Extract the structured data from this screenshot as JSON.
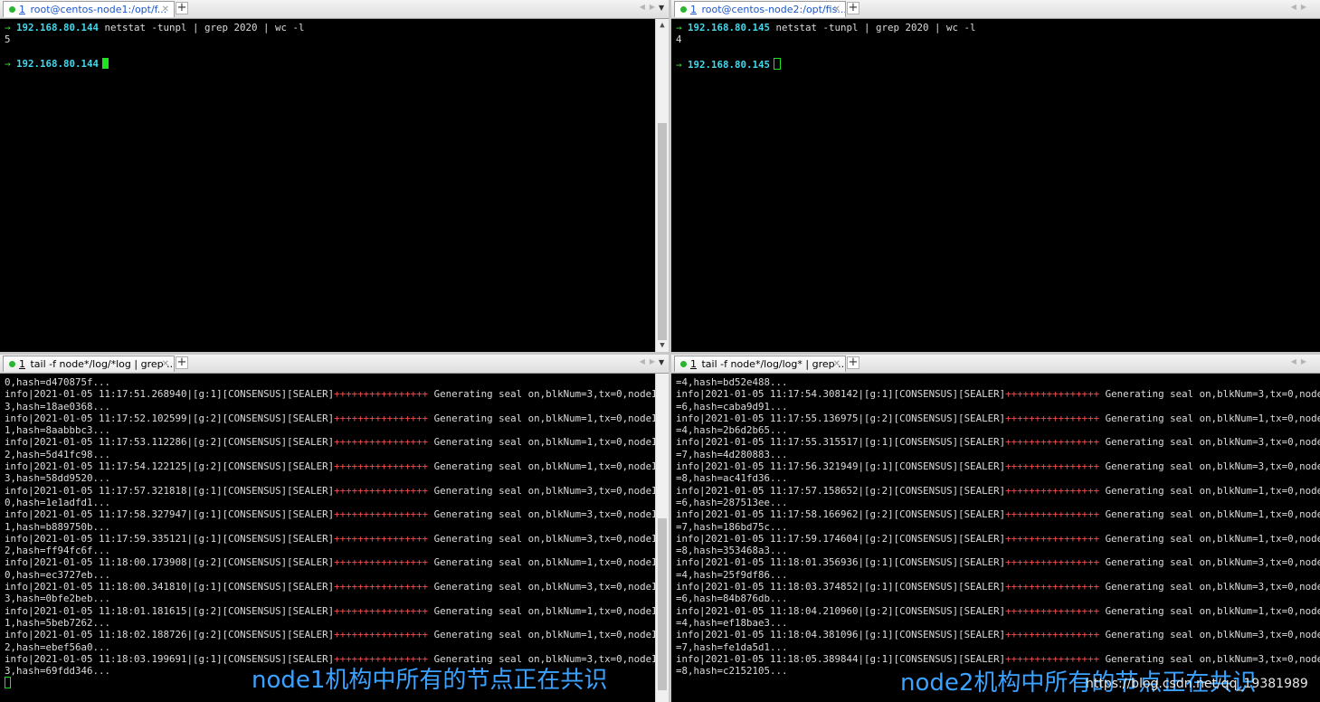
{
  "panes": {
    "top_left": {
      "tab": {
        "num": "1",
        "title": " root@centos-node1:/opt/f..."
      },
      "commands": [
        {
          "host": "192.168.80.144",
          "cmd": " netstat -tunpl | grep 2020 | wc -l"
        },
        {
          "output": "5"
        },
        {
          "output": ""
        },
        {
          "host": "192.168.80.144",
          "cmd": ""
        }
      ]
    },
    "top_right": {
      "tab": {
        "num": "1",
        "title": " root@centos-node2:/opt/fis..."
      },
      "commands": [
        {
          "host": "192.168.80.145",
          "cmd": " netstat -tunpl | grep 2020 | wc -l"
        },
        {
          "output": "4"
        },
        {
          "output": ""
        },
        {
          "host": "192.168.80.145",
          "cmd": ""
        }
      ]
    },
    "bottom_left": {
      "tab": {
        "num": "1",
        "title": " tail -f node*/log/*log | grep ..."
      },
      "first_line": "0,hash=d470875f...",
      "logs": [
        {
          "time": "2021-01-05 11:17:51.268940",
          "group": "1",
          "blk": "3",
          "idx": "3",
          "hash": "18ae0368..."
        },
        {
          "time": "2021-01-05 11:17:52.102599",
          "group": "2",
          "blk": "1",
          "idx": "1",
          "hash": "8aabbbc3..."
        },
        {
          "time": "2021-01-05 11:17:53.112286",
          "group": "2",
          "blk": "1",
          "idx": "2",
          "hash": "5d41fc98..."
        },
        {
          "time": "2021-01-05 11:17:54.122125",
          "group": "2",
          "blk": "1",
          "idx": "3",
          "hash": "58dd9520..."
        },
        {
          "time": "2021-01-05 11:17:57.321818",
          "group": "1",
          "blk": "3",
          "idx": "0",
          "hash": "1e1adfd1..."
        },
        {
          "time": "2021-01-05 11:17:58.327947",
          "group": "1",
          "blk": "3",
          "idx": "1",
          "hash": "b889750b..."
        },
        {
          "time": "2021-01-05 11:17:59.335121",
          "group": "1",
          "blk": "3",
          "idx": "2",
          "hash": "ff94fc6f..."
        },
        {
          "time": "2021-01-05 11:18:00.173908",
          "group": "2",
          "blk": "1",
          "idx": "0",
          "hash": "ec3727eb..."
        },
        {
          "time": "2021-01-05 11:18:00.341810",
          "group": "1",
          "blk": "3",
          "idx": "3",
          "hash": "0bfe2beb..."
        },
        {
          "time": "2021-01-05 11:18:01.181615",
          "group": "2",
          "blk": "1",
          "idx": "1",
          "hash": "5beb7262..."
        },
        {
          "time": "2021-01-05 11:18:02.188726",
          "group": "2",
          "blk": "1",
          "idx": "2",
          "hash": "ebef56a0..."
        },
        {
          "time": "2021-01-05 11:18:03.199691",
          "group": "1",
          "blk": "3",
          "idx": "3",
          "hash": "69fdd346..."
        }
      ]
    },
    "bottom_right": {
      "tab": {
        "num": "1",
        "title": " tail -f node*/log/log* | grep ..."
      },
      "first_line": "=4,hash=bd52e488...",
      "logs": [
        {
          "time": "2021-01-05 11:17:54.308142",
          "group": "1",
          "blk": "3",
          "idx": "6",
          "hash": "caba9d91..."
        },
        {
          "time": "2021-01-05 11:17:55.136975",
          "group": "2",
          "blk": "1",
          "idx": "4",
          "hash": "2b6d2b65..."
        },
        {
          "time": "2021-01-05 11:17:55.315517",
          "group": "1",
          "blk": "3",
          "idx": "7",
          "hash": "4d280883..."
        },
        {
          "time": "2021-01-05 11:17:56.321949",
          "group": "1",
          "blk": "3",
          "idx": "8",
          "hash": "ac41fd36..."
        },
        {
          "time": "2021-01-05 11:17:57.158652",
          "group": "2",
          "blk": "1",
          "idx": "6",
          "hash": "287513ee..."
        },
        {
          "time": "2021-01-05 11:17:58.166962",
          "group": "2",
          "blk": "1",
          "idx": "7",
          "hash": "186bd75c..."
        },
        {
          "time": "2021-01-05 11:17:59.174604",
          "group": "2",
          "blk": "1",
          "idx": "8",
          "hash": "353468a3..."
        },
        {
          "time": "2021-01-05 11:18:01.356936",
          "group": "1",
          "blk": "3",
          "idx": "4",
          "hash": "25f9df86..."
        },
        {
          "time": "2021-01-05 11:18:03.374852",
          "group": "1",
          "blk": "3",
          "idx": "6",
          "hash": "84b876db..."
        },
        {
          "time": "2021-01-05 11:18:04.210960",
          "group": "2",
          "blk": "1",
          "idx": "4",
          "hash": "ef18bae3..."
        },
        {
          "time": "2021-01-05 11:18:04.381096",
          "group": "1",
          "blk": "3",
          "idx": "7",
          "hash": "fe1da5d1..."
        },
        {
          "time": "2021-01-05 11:18:05.389844",
          "group": "1",
          "blk": "3",
          "idx": "8",
          "hash": "c2152105..."
        }
      ]
    }
  },
  "log_format": {
    "level": "info",
    "module": "[CONSENSUS][SEALER]",
    "plus": "++++++++++++++++",
    "msg": " Generating seal on,blkNum=",
    "tx": ",tx=0,nodeIdx="
  },
  "overlays": {
    "left_caption": "node1机构中所有的节点正在共识",
    "right_caption": "node2机构中所有的节点正在共识",
    "watermark": "https://blog.csdn.net/qq_19381989"
  },
  "colors": {
    "prompt_arrow": "#3fdd3f",
    "host": "#41d8ee",
    "plus": "#f05050",
    "cursor": "#1ee31e",
    "caption": "#3ba2ff"
  }
}
